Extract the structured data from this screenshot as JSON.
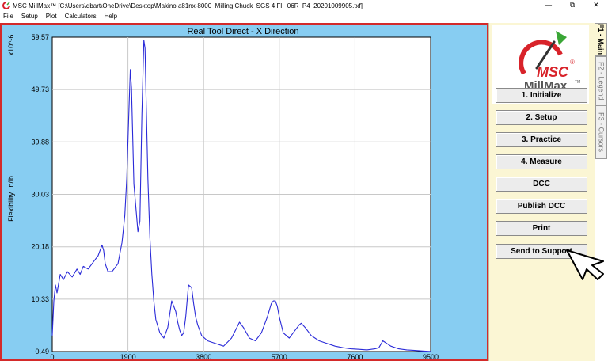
{
  "window": {
    "title": "MSC MillMax™ [C:\\Users\\dbart\\OneDrive\\Desktop\\Makino a81nx-8000_Milling Chuck_SGS 4 Fl _06R_P4_20201009905.txf]",
    "controls": [
      "—",
      "⧉",
      "✕"
    ]
  },
  "menu": [
    "File",
    "Setup",
    "Plot",
    "Calculators",
    "Help"
  ],
  "logo": {
    "brand": "MSC",
    "product": "MillMax",
    "tm": "TM",
    "reg": "®"
  },
  "buttons": [
    "1. Initialize",
    "2. Setup",
    "3. Practice",
    "4. Measure",
    "DCC",
    "Publish DCC",
    "Print",
    "Send to Support"
  ],
  "tabs": [
    "F1 - Main",
    "F2 - Legend",
    "F3 - Cursors"
  ],
  "colors": {
    "plot_bg": "#87cdf2",
    "plot_border": "#d42a2a",
    "line": "#2a2ad8",
    "panel_bg": "#fbf6d4",
    "logo_red": "#d8232a",
    "logo_green": "#3aa636"
  },
  "chart_data": {
    "type": "line",
    "title": "Real Tool Direct - X Direction",
    "ylabel": "Flexibility, in/lb",
    "yscale_label": "x10^-6",
    "xlim": [
      0,
      9500
    ],
    "ylim": [
      0.49,
      59.57
    ],
    "x_ticks": [
      "0",
      "1900",
      "3800",
      "5700",
      "7600",
      "9500"
    ],
    "y_ticks": [
      "0.49",
      "10.33",
      "20.18",
      "30.03",
      "39.88",
      "49.73",
      "59.57"
    ],
    "series": [
      {
        "x": [
          0,
          40,
          80,
          120,
          200,
          280,
          380,
          500,
          620,
          700,
          780,
          900,
          1050,
          1150,
          1250,
          1290,
          1330,
          1400,
          1500,
          1650,
          1750,
          1820,
          1870,
          1900,
          1930,
          1960,
          1990,
          2050,
          2150,
          2200,
          2250,
          2300,
          2330,
          2360,
          2400,
          2450,
          2500,
          2550,
          2600,
          2700,
          2800,
          2900,
          3000,
          3100,
          3150,
          3200,
          3250,
          3300,
          3350,
          3420,
          3500,
          3550,
          3600,
          3650,
          3750,
          3900,
          4100,
          4300,
          4500,
          4600,
          4700,
          4800,
          4950,
          5100,
          5250,
          5400,
          5500,
          5550,
          5600,
          5650,
          5700,
          5800,
          5950,
          6100,
          6200,
          6250,
          6350,
          6500,
          6700,
          6900,
          7100,
          7300,
          7500,
          7700,
          7900,
          8100,
          8200,
          8300,
          8500,
          8700,
          8900,
          9100,
          9300,
          9500
        ],
        "y": [
          3.5,
          10.0,
          13.0,
          11.5,
          15.0,
          14.0,
          15.5,
          14.5,
          16.0,
          15.0,
          16.5,
          16.0,
          17.5,
          18.5,
          20.5,
          19.5,
          17.0,
          15.5,
          15.5,
          17.0,
          21.0,
          26.0,
          33.0,
          40.0,
          47.0,
          53.5,
          50.0,
          32.0,
          23.0,
          25.0,
          45.0,
          59.0,
          57.5,
          47.0,
          33.0,
          22.0,
          15.0,
          10.0,
          6.5,
          4.0,
          3.0,
          5.0,
          10.0,
          8.0,
          6.0,
          4.5,
          3.5,
          4.0,
          7.0,
          13.0,
          12.5,
          9.5,
          7.0,
          5.5,
          3.5,
          2.5,
          2.0,
          1.5,
          3.0,
          4.5,
          6.0,
          5.0,
          3.0,
          2.5,
          4.0,
          7.0,
          9.5,
          10.0,
          10.0,
          9.0,
          7.0,
          4.0,
          3.0,
          4.5,
          5.5,
          5.8,
          5.0,
          3.5,
          2.5,
          2.0,
          1.5,
          1.2,
          1.0,
          0.9,
          0.8,
          1.0,
          1.2,
          2.5,
          1.5,
          1.0,
          0.8,
          0.7,
          0.6,
          0.5
        ]
      }
    ]
  }
}
